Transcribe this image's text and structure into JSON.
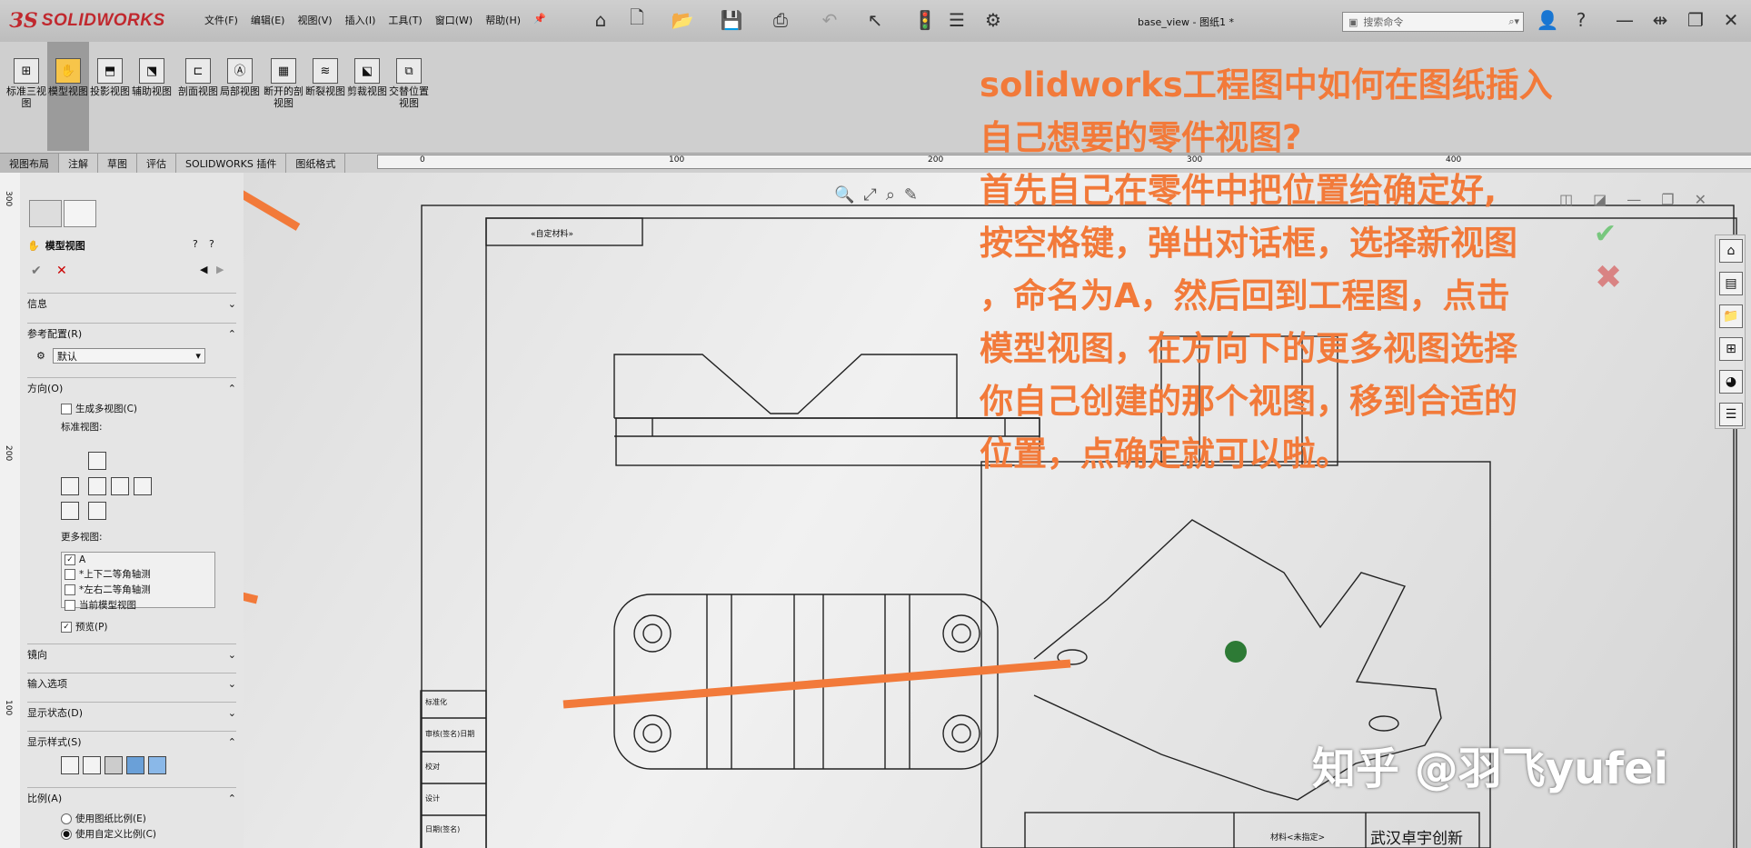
{
  "app": {
    "brand": "SOLIDWORKS",
    "doc_title": "base_view - 图纸1 *"
  },
  "menu": [
    "文件(F)",
    "编辑(E)",
    "视图(V)",
    "插入(I)",
    "工具(T)",
    "窗口(W)",
    "帮助(H)"
  ],
  "search": {
    "placeholder": "搜索命令"
  },
  "toolbar_icons": [
    "home-icon",
    "new-doc-icon",
    "open-icon",
    "save-icon",
    "print-icon",
    "undo-icon",
    "select-pointer-icon",
    "traffic-light-icon",
    "list-icon",
    "gear-icon"
  ],
  "command_buttons": [
    {
      "label": "标准三视图"
    },
    {
      "label": "模型视图"
    },
    {
      "label": "投影视图"
    },
    {
      "label": "辅助视图"
    },
    {
      "label": "剖面视图"
    },
    {
      "label": "局部视图"
    },
    {
      "label": "断开的剖视图"
    },
    {
      "label": "断裂视图"
    },
    {
      "label": "剪裁视图"
    },
    {
      "label": "交替位置视图"
    }
  ],
  "tabs": [
    "视图布局",
    "注解",
    "草图",
    "评估",
    "SOLIDWORKS 插件",
    "图纸格式"
  ],
  "ruler_top": [
    "0",
    "100",
    "200",
    "300",
    "400"
  ],
  "ruler_left": [
    "300",
    "200",
    "100"
  ],
  "panel": {
    "title": "模型视图",
    "sections": {
      "info": "信息",
      "ref_config": "参考配置(R)",
      "config_value": "默认",
      "orientation": "方向(O)",
      "gen_multi": "生成多视图(C)",
      "std_views": "标准视图:",
      "more_views": "更多视图:",
      "more_list": [
        "A",
        "*上下二等角轴测",
        "*左右二等角轴测",
        "当前模型视图"
      ],
      "preview": "预览(P)",
      "mirror": "镜向",
      "import": "输入选项",
      "display_state": "显示状态(D)",
      "display_style": "显示样式(S)",
      "scale": "比例(A)",
      "scale_sheet": "使用图纸比例(E)",
      "scale_custom": "使用自定义比例(C)"
    }
  },
  "drawing": {
    "title_block_label": "«自定材料»",
    "table_rows": [
      "标准化",
      "审核(签名)日期",
      "校对",
      "设计",
      "日期(签名)"
    ],
    "company": "武汉卓宇创新",
    "material": "材料<未指定>"
  },
  "overlay_text": [
    "solidworks工程图中如何在图纸插入",
    "自己想要的零件视图?",
    "首先自己在零件中把位置给确定好,",
    "按空格键，弹出对话框，选择新视图",
    "，命名为A，然后回到工程图，点击",
    "模型视图，在方向下的更多视图选择",
    "你自己创建的那个视图，移到合适的",
    "位置，点确定就可以啦。"
  ],
  "watermark": "知乎 @羽飞yufei",
  "colors": {
    "annotation_orange": "#f27a3a",
    "brand_red": "#c0282e"
  }
}
